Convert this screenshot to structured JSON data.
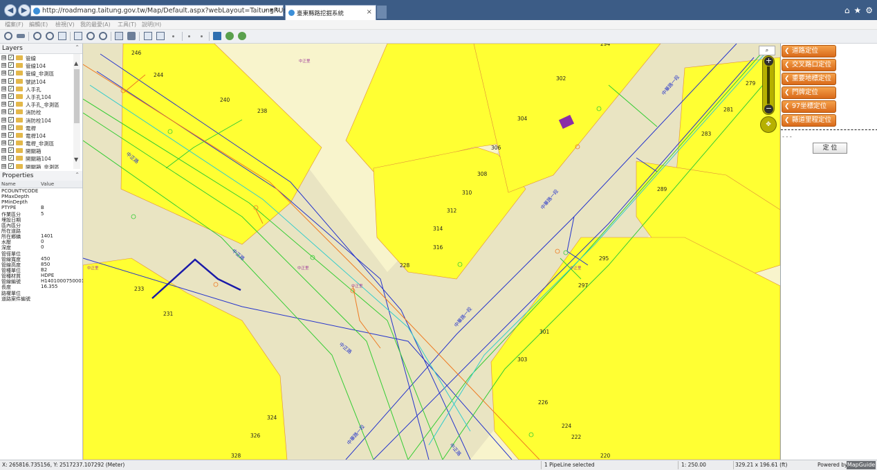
{
  "browser": {
    "url": "http://roadmang.taitung.gov.tw/Map/Default.aspx?webLayout=TaitungRUse.Web",
    "address_controls": "⌕ ▾ ↻",
    "tab_title": "臺東縣路挖掘系統",
    "tab_close": "×",
    "nav_back": "◀",
    "nav_forward": "▶",
    "icons": {
      "home": "⌂",
      "favorites": "★",
      "settings": "⚙"
    }
  },
  "menu": [
    "檔案(F)",
    "編輯(E)",
    "檢視(V)",
    "我的最愛(A)",
    "工具(T)",
    "說明(H)"
  ],
  "layers": {
    "title": "Layers",
    "collapse": "⌃",
    "check": "✓",
    "expand": "⊞",
    "items": [
      "管線",
      "管線104",
      "管線_非測區",
      "號誌104",
      "人手孔",
      "人手孔104",
      "人手孔_非測區",
      "消防栓",
      "消防栓104",
      "電桿",
      "電桿104",
      "電桿_非測區",
      "開關箱",
      "開關箱104",
      "開關箱_非測區"
    ]
  },
  "properties": {
    "title": "Properties",
    "collapse": "⌃",
    "col_name": "Name",
    "col_value": "Value",
    "rows": [
      {
        "k": "PCOUNTYCODE",
        "v": ""
      },
      {
        "k": "PMaxDepth",
        "v": ""
      },
      {
        "k": "PMinDepth",
        "v": ""
      },
      {
        "k": "PTYPE",
        "v": "B"
      },
      {
        "k": "作業區分",
        "v": "5"
      },
      {
        "k": "埋設日期",
        "v": ""
      },
      {
        "k": "區內區分",
        "v": ""
      },
      {
        "k": "所在道路",
        "v": ""
      },
      {
        "k": "所在鄉鎮",
        "v": "1401"
      },
      {
        "k": "水壓",
        "v": "0"
      },
      {
        "k": "深度",
        "v": "0"
      },
      {
        "k": "管徑單位",
        "v": ""
      },
      {
        "k": "管線寬度",
        "v": "450"
      },
      {
        "k": "管線高度",
        "v": "850"
      },
      {
        "k": "管種單位",
        "v": "B2"
      },
      {
        "k": "管種材質",
        "v": "HDPE"
      },
      {
        "k": "管線編號",
        "v": "H1401000750001"
      },
      {
        "k": "長度",
        "v": "16.355"
      },
      {
        "k": "路權單位",
        "v": ""
      },
      {
        "k": "道路案件編號",
        "v": ""
      }
    ]
  },
  "map": {
    "zoom_mag": "⌕",
    "zoom_in": "+",
    "zoom_out": "−",
    "pan": "✥",
    "numbers": [
      "246",
      "244",
      "240",
      "238",
      "233",
      "231",
      "228",
      "316",
      "314",
      "312",
      "310",
      "308",
      "306",
      "304",
      "302",
      "294",
      "279",
      "281",
      "283",
      "289",
      "295",
      "297",
      "301",
      "303",
      "226",
      "224",
      "222",
      "220",
      "324",
      "326",
      "328"
    ],
    "road_labels": [
      "中正路",
      "中正路",
      "中正路",
      "中華路一段",
      "中華路一段",
      "中華路一段",
      "中華路一段",
      "中正路"
    ],
    "area_labels": [
      "中正里",
      "中正里",
      "中正里",
      "中正里",
      "中正里"
    ],
    "colors": {
      "block": "#ffff33",
      "road": "#e9e4c2",
      "background": "#f8f4cc",
      "blue_line": "#2433cc",
      "green_line": "#33cc33",
      "cyan_line": "#33cccc",
      "orange_line": "#ee7a22",
      "selected": "#1a1aa8"
    }
  },
  "right_panel": {
    "buttons": [
      "道路定位",
      "交叉路口定位",
      "重要地標定位",
      "門牌定位",
      "97坐標定位",
      "縣道里程定位"
    ],
    "arrow": "❮",
    "dots": "- - -",
    "locate_button": "定 位"
  },
  "status": {
    "coords": "X: 265816.735156, Y: 2517237.107292 (Meter)",
    "selection": "1 PipeLine selected",
    "scale": "1: 250.00",
    "size": "329.21 x 196.61 (ft)",
    "powered_by": "Powered by",
    "logo": "MapGuide"
  }
}
